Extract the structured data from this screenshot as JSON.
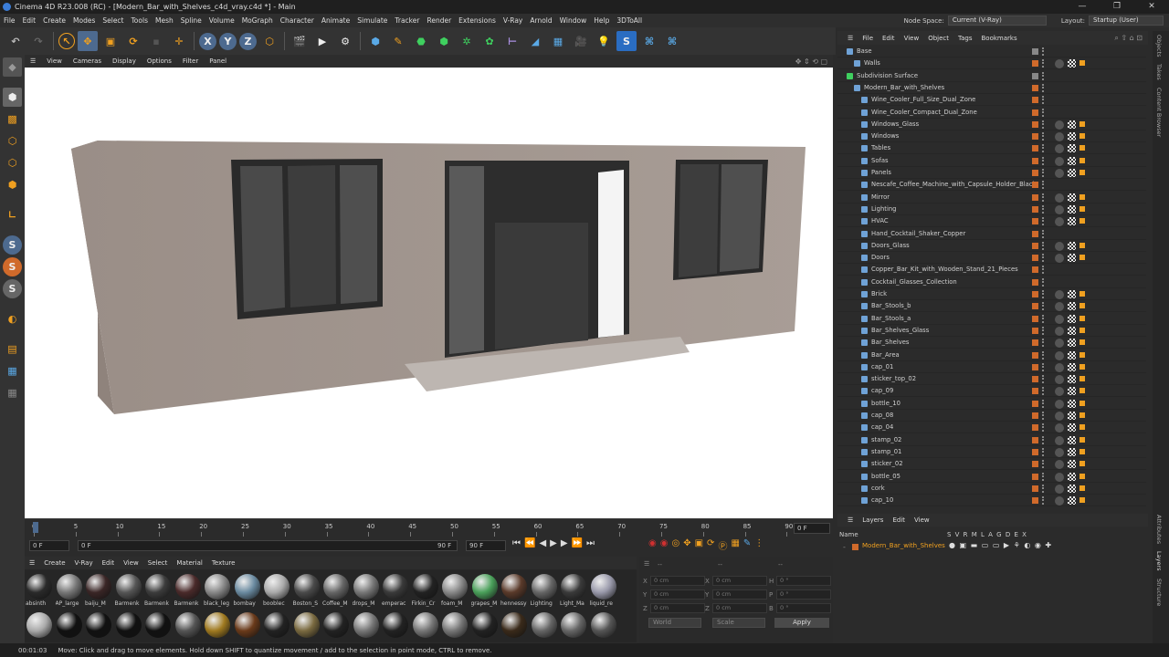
{
  "title_bar": {
    "title": "Cinema 4D R23.008 (RC) - [Modern_Bar_with_Shelves_c4d_vray.c4d *] - Main",
    "buttons": [
      "—",
      "❐",
      "✕"
    ]
  },
  "menu": {
    "items": [
      "File",
      "Edit",
      "Create",
      "Modes",
      "Select",
      "Tools",
      "Mesh",
      "Spline",
      "Volume",
      "MoGraph",
      "Character",
      "Animate",
      "Simulate",
      "Tracker",
      "Render",
      "Extensions",
      "V-Ray",
      "Arnold",
      "Window",
      "Help",
      "3DToAll"
    ],
    "node_space_label": "Node Space:",
    "node_space_value": "Current (V-Ray)",
    "layout_label": "Layout:",
    "layout_value": "Startup (User)"
  },
  "viewport_menu": [
    "View",
    "Cameras",
    "Display",
    "Options",
    "Filter",
    "Panel"
  ],
  "timeline": {
    "ticks": [
      "0",
      "5",
      "10",
      "15",
      "20",
      "25",
      "30",
      "35",
      "40",
      "45",
      "50",
      "55",
      "60",
      "65",
      "70",
      "75",
      "80",
      "85",
      "90"
    ],
    "current_frame": "0 F",
    "start": "0 F",
    "range_start": "0 F",
    "range_end": "90 F",
    "end": "90 F"
  },
  "material_menu": [
    "Create",
    "V-Ray",
    "Edit",
    "View",
    "Select",
    "Material",
    "Texture"
  ],
  "materials_row1": [
    "absinth",
    "AP_large",
    "baiju_M",
    "Barmenk",
    "Barmenk",
    "Barmenk",
    "black_leg",
    "bombay",
    "booblec",
    "Boston_S",
    "Coffee_M",
    "drops_M",
    "emperac",
    "Firkin_Cr",
    "foam_M",
    "grapes_M",
    "hennessy",
    "Lighting",
    "Light_Ma",
    "liquid_re"
  ],
  "coords": {
    "dashes": [
      "--",
      "--",
      "--"
    ],
    "rows": [
      {
        "axis": "X",
        "v1": "0 cm",
        "axis2": "X",
        "v2": "0 cm",
        "axis3": "H",
        "v3": "0 °"
      },
      {
        "axis": "Y",
        "v1": "0 cm",
        "axis2": "Y",
        "v2": "0 cm",
        "axis3": "P",
        "v3": "0 °"
      },
      {
        "axis": "Z",
        "v1": "0 cm",
        "axis2": "Z",
        "v2": "0 cm",
        "axis3": "B",
        "v3": "0 °"
      }
    ],
    "mode": "World",
    "scale": "Scale",
    "apply": "Apply"
  },
  "status": {
    "time": "00:01:03",
    "message": "Move: Click and drag to move elements. Hold down SHIFT to quantize movement / add to the selection in point mode, CTRL to remove."
  },
  "object_manager": {
    "menu": [
      "File",
      "Edit",
      "View",
      "Object",
      "Tags",
      "Bookmarks"
    ],
    "objects": [
      {
        "name": "Base",
        "indent": 0
      },
      {
        "name": "Walls",
        "indent": 1
      },
      {
        "name": "Subdivision Surface",
        "indent": 0
      },
      {
        "name": "Modern_Bar_with_Shelves",
        "indent": 1
      },
      {
        "name": "Wine_Cooler_Full_Size_Dual_Zone",
        "indent": 2
      },
      {
        "name": "Wine_Cooler_Compact_Dual_Zone",
        "indent": 2
      },
      {
        "name": "Windows_Glass",
        "indent": 2
      },
      {
        "name": "Windows",
        "indent": 2
      },
      {
        "name": "Tables",
        "indent": 2
      },
      {
        "name": "Sofas",
        "indent": 2
      },
      {
        "name": "Panels",
        "indent": 2
      },
      {
        "name": "Nescafe_Coffee_Machine_with_Capsule_Holder_Black",
        "indent": 2
      },
      {
        "name": "Mirror",
        "indent": 2
      },
      {
        "name": "Lighting",
        "indent": 2
      },
      {
        "name": "HVAC",
        "indent": 2
      },
      {
        "name": "Hand_Cocktail_Shaker_Copper",
        "indent": 2
      },
      {
        "name": "Doors_Glass",
        "indent": 2
      },
      {
        "name": "Doors",
        "indent": 2
      },
      {
        "name": "Copper_Bar_Kit_with_Wooden_Stand_21_Pieces",
        "indent": 2
      },
      {
        "name": "Cocktail_Glasses_Collection",
        "indent": 2
      },
      {
        "name": "Brick",
        "indent": 2
      },
      {
        "name": "Bar_Stools_b",
        "indent": 2
      },
      {
        "name": "Bar_Stools_a",
        "indent": 2
      },
      {
        "name": "Bar_Shelves_Glass",
        "indent": 2
      },
      {
        "name": "Bar_Shelves",
        "indent": 2
      },
      {
        "name": "Bar_Area",
        "indent": 2
      },
      {
        "name": "cap_01",
        "indent": 2
      },
      {
        "name": "sticker_top_02",
        "indent": 2
      },
      {
        "name": "cap_09",
        "indent": 2
      },
      {
        "name": "bottle_10",
        "indent": 2
      },
      {
        "name": "cap_08",
        "indent": 2
      },
      {
        "name": "cap_04",
        "indent": 2
      },
      {
        "name": "stamp_02",
        "indent": 2
      },
      {
        "name": "stamp_01",
        "indent": 2
      },
      {
        "name": "sticker_02",
        "indent": 2
      },
      {
        "name": "bottle_05",
        "indent": 2
      },
      {
        "name": "cork",
        "indent": 2
      },
      {
        "name": "cap_10",
        "indent": 2
      }
    ]
  },
  "layers": {
    "menu": [
      "Layers",
      "Edit",
      "View"
    ],
    "col_name": "Name",
    "col_flags": "S V R M L A G D E X",
    "items": [
      {
        "name": "Modern_Bar_with_Shelves",
        "color": "#d06a2b"
      }
    ]
  },
  "right_tabs": [
    "Objects",
    "Takes",
    "Content Browser",
    "Attributes",
    "Layers",
    "Structure"
  ],
  "colors": {
    "accent_orange": "#d06a2b",
    "accent_blue": "#3b7dd8",
    "viewport_bg": "#ffffff"
  }
}
